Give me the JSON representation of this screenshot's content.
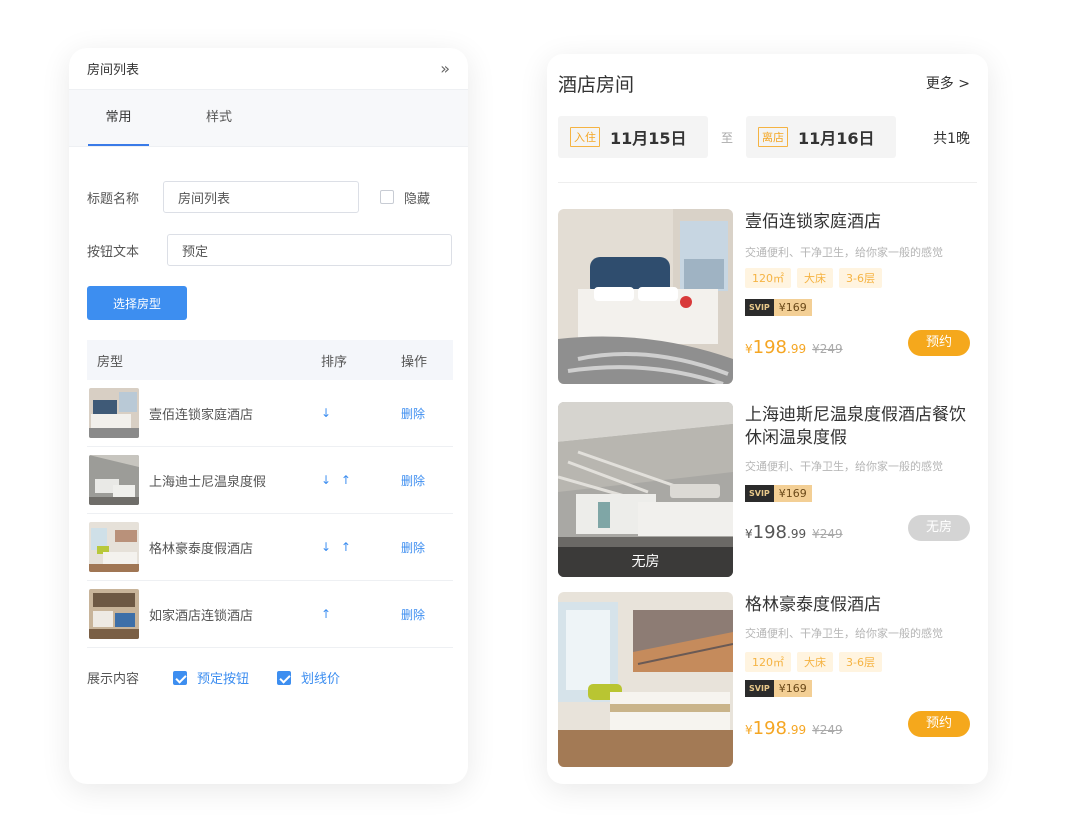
{
  "panel": {
    "title": "房间列表",
    "tabs": [
      "常用",
      "样式"
    ],
    "title_field": {
      "label": "标题名称",
      "value": "房间列表"
    },
    "hide_option": "隐藏",
    "button_text_field": {
      "label": "按钮文本",
      "value": "预定"
    },
    "select_button": "选择房型",
    "table": {
      "headers": [
        "房型",
        "排序",
        "操作"
      ],
      "rows": [
        {
          "name": "壹佰连锁家庭酒店",
          "sort": [
            "↓"
          ],
          "action": "删除"
        },
        {
          "name": "上海迪士尼温泉度假",
          "sort": [
            "↓",
            "↑"
          ],
          "action": "删除"
        },
        {
          "name": "格林豪泰度假酒店",
          "sort": [
            "↓",
            "↑"
          ],
          "action": "删除"
        },
        {
          "name": "如家酒店连锁酒店",
          "sort": [
            "↑"
          ],
          "action": "删除"
        }
      ]
    },
    "display": {
      "label": "展示内容",
      "options": [
        {
          "label": "预定按钮",
          "checked": true
        },
        {
          "label": "划线价",
          "checked": true
        }
      ]
    }
  },
  "preview": {
    "title": "酒店房间",
    "more": "更多 >",
    "checkin": {
      "tag": "入住",
      "date": "11月15日"
    },
    "separator": "至",
    "checkout": {
      "tag": "离店",
      "date": "11月16日"
    },
    "nights": "共1晚",
    "hotels": [
      {
        "name": "壹佰连锁家庭酒店",
        "desc": "交通便利、干净卫生，给你家一般的感觉",
        "tags": [
          "120㎡",
          "大床",
          "3-6层"
        ],
        "svip_label": "SVIP",
        "svip_price": "¥169",
        "currency": "¥",
        "price_int": "198",
        "price_dec": ".99",
        "orig_price": "¥249",
        "button": "预约",
        "available": true
      },
      {
        "name": "上海迪斯尼温泉度假酒店餐饮休闲温泉度假",
        "desc": "交通便利、干净卫生，给你家一般的感觉",
        "tags": [],
        "svip_label": "SVIP",
        "svip_price": "¥169",
        "currency": "¥",
        "price_int": "198",
        "price_dec": ".99",
        "orig_price": "¥249",
        "button": "无房",
        "soldout_overlay": "无房",
        "available": false
      },
      {
        "name": "格林豪泰度假酒店",
        "desc": "交通便利、干净卫生，给你家一般的感觉",
        "tags": [
          "120㎡",
          "大床",
          "3-6层"
        ],
        "svip_label": "SVIP",
        "svip_price": "¥169",
        "currency": "¥",
        "price_int": "198",
        "price_dec": ".99",
        "orig_price": "¥249",
        "button": "预约",
        "available": true
      }
    ]
  },
  "colors": {
    "primary_blue": "#3d8ef0",
    "accent_orange": "#f5a81c",
    "disabled_grey": "#d4d4d4"
  }
}
